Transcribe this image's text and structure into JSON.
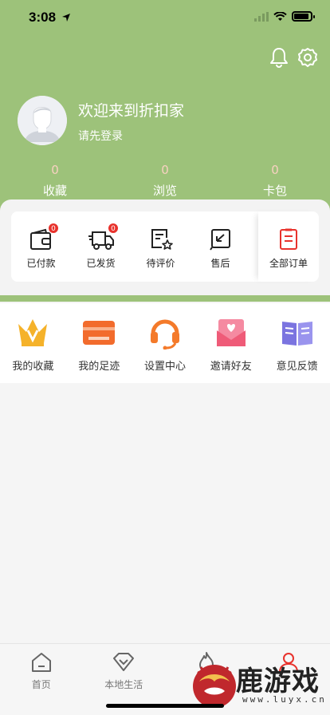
{
  "status_bar": {
    "time": "3:08"
  },
  "profile": {
    "welcome": "欢迎来到折扣家",
    "login_prompt": "请先登录"
  },
  "stats": [
    {
      "value": "0",
      "label": "收藏"
    },
    {
      "value": "0",
      "label": "浏览"
    },
    {
      "value": "0",
      "label": "卡包"
    }
  ],
  "orders": {
    "items": [
      {
        "label": "已付款",
        "icon": "wallet-icon",
        "badge": "0"
      },
      {
        "label": "已发货",
        "icon": "truck-icon",
        "badge": "0"
      },
      {
        "label": "待评价",
        "icon": "review-icon"
      },
      {
        "label": "售后",
        "icon": "after-sales-icon"
      }
    ],
    "all_label": "全部订单"
  },
  "menu": [
    {
      "label": "我的收藏",
      "icon": "crown-icon",
      "color": "#f5b22a"
    },
    {
      "label": "我的足迹",
      "icon": "card-icon",
      "color": "#f26b2c"
    },
    {
      "label": "设置中心",
      "icon": "headset-icon",
      "color": "#f47a2a"
    },
    {
      "label": "邀请好友",
      "icon": "invite-icon",
      "color": "#ef5b78"
    },
    {
      "label": "意见反馈",
      "icon": "book-icon",
      "color": "#7b74e0"
    }
  ],
  "tabbar": [
    {
      "label": "首页",
      "icon": "home-icon"
    },
    {
      "label": "本地生活",
      "icon": "diamond-icon"
    },
    {
      "label": "",
      "icon": "flame-icon"
    },
    {
      "label": "",
      "icon": "profile-icon"
    }
  ],
  "watermark": {
    "text": "鹿游戏",
    "url": "www.luyx.cn"
  },
  "colors": {
    "header": "#9dc27a",
    "badge": "#e8322c",
    "accent_red": "#e8322c"
  }
}
